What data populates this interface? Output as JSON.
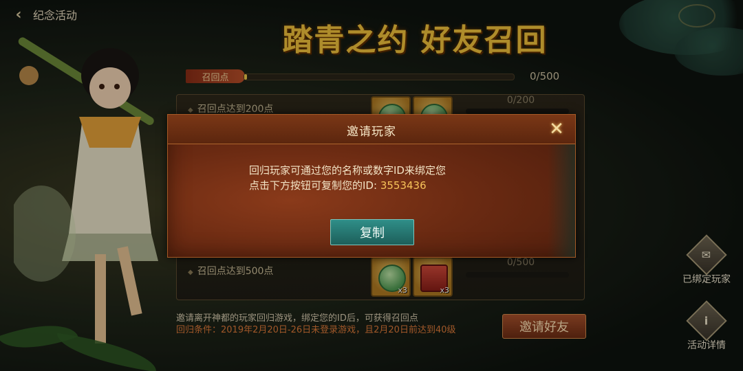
{
  "nav": {
    "back_label": "纪念活动"
  },
  "event": {
    "title": "踏青之约 好友召回"
  },
  "progress": {
    "label": "召回点",
    "current": 0,
    "max": 500,
    "count_text": "0/500"
  },
  "tiers": [
    {
      "requirement": "召回点达到200点",
      "count_text": "0/200",
      "rewards": [
        {
          "icon": "jade-ball-icon",
          "qty": ""
        },
        {
          "icon": "jade-token-icon",
          "qty": ""
        }
      ]
    },
    {
      "requirement": "召回点达到500点",
      "count_text": "0/500",
      "rewards": [
        {
          "icon": "jade-token-icon",
          "qty": "x3"
        },
        {
          "icon": "gift-box-icon",
          "qty": "x3"
        }
      ]
    }
  ],
  "footer": {
    "line1": "邀请离开神都的玩家回归游戏，绑定您的ID后，可获得召回点",
    "line2": "回归条件：2019年2月20日-26日未登录游戏，且2月20日前达到40级"
  },
  "invite_button": "邀请好友",
  "side": {
    "bound_players": "已绑定玩家",
    "event_details": "活动详情"
  },
  "modal": {
    "title": "邀请玩家",
    "line1": "回归玩家可通过您的名称或数字ID来绑定您",
    "line2_prefix": "点击下方按钮可复制您的ID: ",
    "player_id": "3553436",
    "copy_button": "复制",
    "close_icon": "close-icon"
  },
  "colors": {
    "title_gold": "#f2c23c",
    "modal_bg": "#6a2a12",
    "copy_button": "#2f8e88",
    "condition_text": "#e07a3a"
  }
}
